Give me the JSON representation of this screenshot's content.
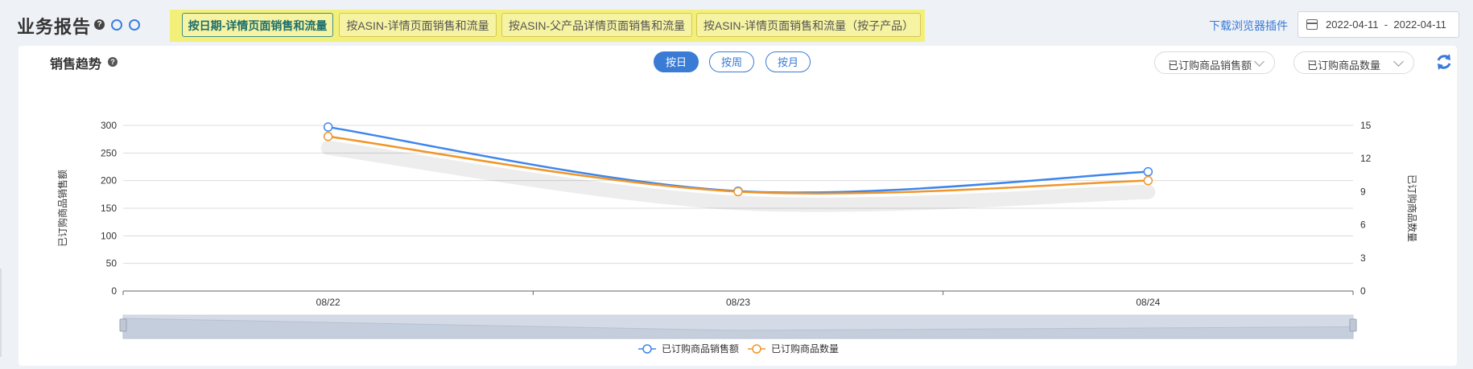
{
  "header": {
    "title": "业务报告",
    "tabs": [
      {
        "label": "按日期-详情页面销售和流量",
        "active": true
      },
      {
        "label": "按ASIN-详情页面销售和流量",
        "active": false
      },
      {
        "label": "按ASIN-父产品详情页面销售和流量",
        "active": false
      },
      {
        "label": "按ASIN-详情页面销售和流量（按子产品）",
        "active": false
      }
    ],
    "download_link": "下载浏览器插件",
    "date_range": {
      "start": "2022-04-11",
      "separator": "-",
      "end": "2022-04-11"
    }
  },
  "section": {
    "title": "销售趋势",
    "period_buttons": [
      {
        "label": "按日",
        "active": true
      },
      {
        "label": "按周",
        "active": false
      },
      {
        "label": "按月",
        "active": false
      }
    ],
    "metric_selects": [
      "已订购商品销售额",
      "已订购商品数量"
    ]
  },
  "colors": {
    "accent": "#3a7bd5",
    "series_sales": "#3d86eb",
    "series_units": "#f0962a",
    "tab_highlight": "#f3f07a"
  },
  "chart_data": {
    "type": "line",
    "x": [
      "08/22",
      "08/23",
      "08/24"
    ],
    "series": [
      {
        "name": "已订购商品销售额",
        "axis": "left",
        "values": [
          297,
          181,
          216
        ]
      },
      {
        "name": "已订购商品数量",
        "axis": "right",
        "values": [
          14,
          9,
          10
        ]
      }
    ],
    "ylabel": "已订购商品销售额",
    "y2label": "已订购商品数量",
    "ylim": [
      0,
      300
    ],
    "y2lim": [
      0,
      15
    ],
    "yticks": [
      0,
      50,
      100,
      150,
      200,
      250,
      300
    ],
    "y2ticks": [
      0,
      3,
      6,
      9,
      12,
      15
    ],
    "grid": true,
    "legend": "bottom-center",
    "has_zoom_slider": true
  }
}
